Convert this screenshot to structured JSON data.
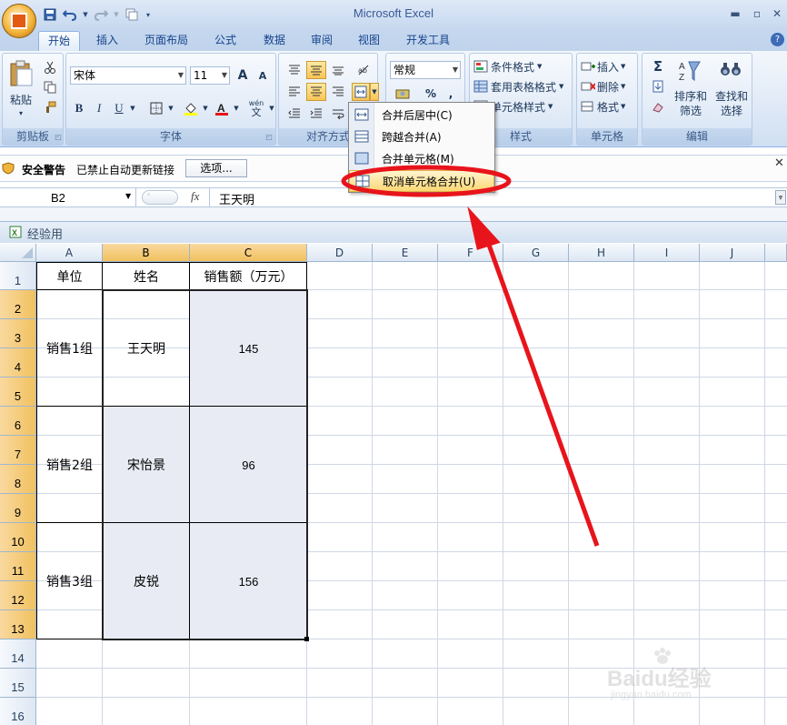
{
  "window": {
    "title": "Microsoft Excel",
    "minimize": "▬",
    "restore": "▫",
    "close": "✕",
    "help": "?"
  },
  "tabs": [
    "开始",
    "插入",
    "页面布局",
    "公式",
    "数据",
    "审阅",
    "视图",
    "开发工具"
  ],
  "ribbon": {
    "clipboard": {
      "paste": "粘贴",
      "group": "剪贴板"
    },
    "font": {
      "name": "宋体",
      "size": "11",
      "bold": "B",
      "italic": "I",
      "underline": "U",
      "group": "字体",
      "grow": "A",
      "shrink": "A",
      "phonetic": "wén",
      "phonetic_char": "文"
    },
    "alignment": {
      "group": "对齐方式"
    },
    "number": {
      "format": "常规",
      "percent": "%",
      "comma": ","
    },
    "styles": {
      "conditional": "条件格式",
      "table": "套用表格格式",
      "cell": "单元格样式",
      "group": "样式"
    },
    "cells": {
      "insert": "插入",
      "delete": "删除",
      "format": "格式",
      "group": "单元格"
    },
    "editing": {
      "sigma": "Σ",
      "sort": "排序和",
      "sort2": "筛选",
      "find": "查找和",
      "find2": "选择",
      "group": "编辑"
    }
  },
  "merge_menu": [
    {
      "label": "合并后居中(C)"
    },
    {
      "label": "跨越合并(A)"
    },
    {
      "label": "合并单元格(M)"
    },
    {
      "label": "取消单元格合并(U)"
    }
  ],
  "security_bar": {
    "title": "安全警告",
    "message": "已禁止自动更新链接",
    "options": "选项..."
  },
  "formula_bar": {
    "name_box": "B2",
    "fx": "fx",
    "value": "王天明"
  },
  "workbook": {
    "name": "经验用"
  },
  "columns": [
    "A",
    "B",
    "C",
    "D",
    "E",
    "F",
    "G",
    "H",
    "I",
    "J"
  ],
  "rows": [
    "1",
    "2",
    "3",
    "4",
    "5",
    "6",
    "7",
    "8",
    "9",
    "10",
    "11",
    "12",
    "13",
    "14",
    "15",
    "16"
  ],
  "table": {
    "headers": [
      "单位",
      "姓名",
      "销售额（万元）"
    ],
    "groups": [
      {
        "unit": "销售1组",
        "name": "王天明",
        "sales": "145"
      },
      {
        "unit": "销售2组",
        "name": "宋怡景",
        "sales": "96"
      },
      {
        "unit": "销售3组",
        "name": "皮锐",
        "sales": "156"
      }
    ]
  },
  "watermark": {
    "text": "Baidu经验",
    "url": "jingyan.baidu.com"
  },
  "colors": {
    "accent_red": "#e8141b",
    "selection_header": "#f1c15f",
    "ribbon_blue": "#15428b",
    "highlight": "#fcd774"
  }
}
